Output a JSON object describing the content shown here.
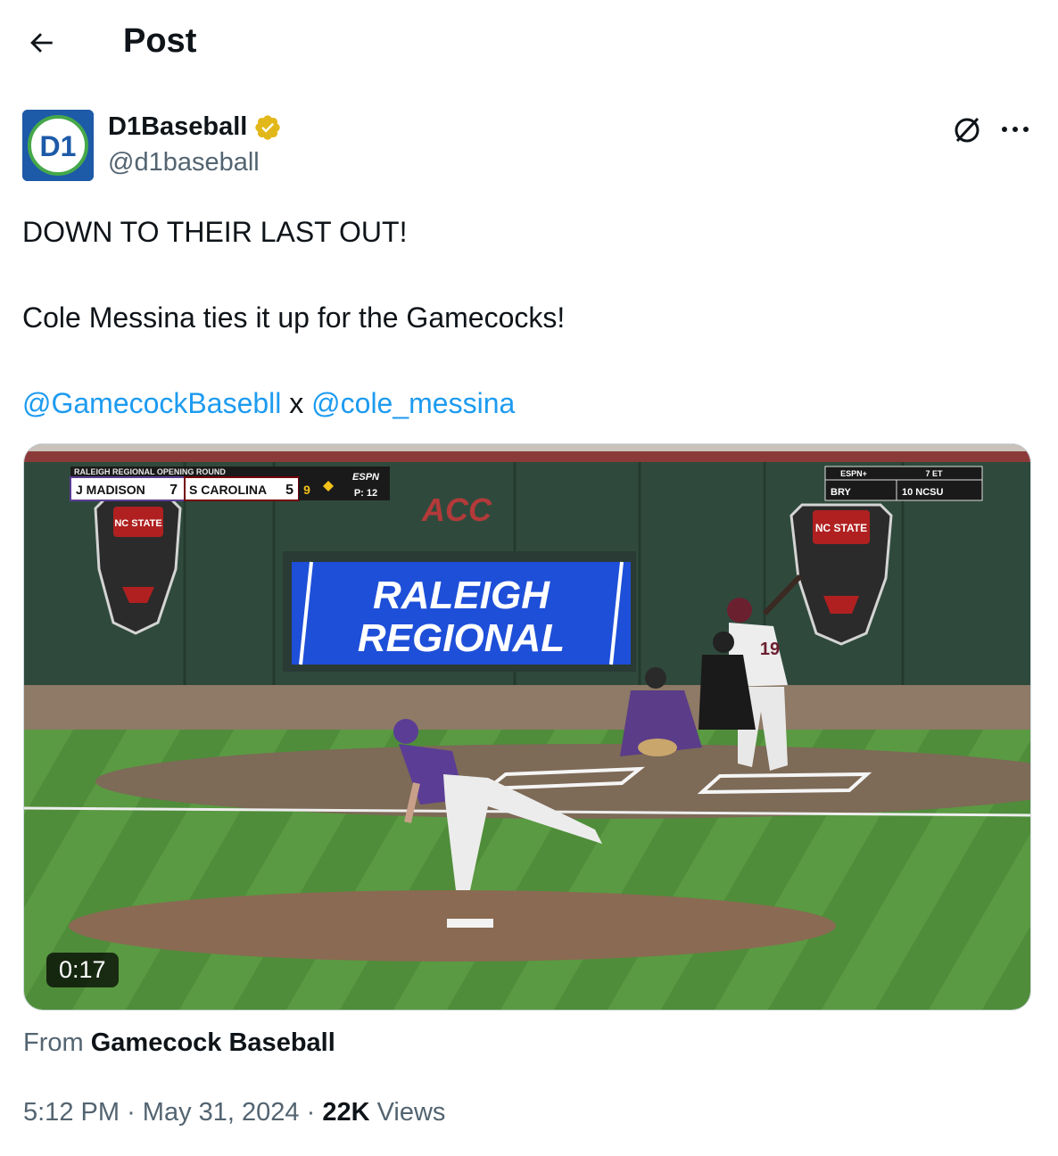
{
  "header": {
    "title": "Post"
  },
  "author": {
    "avatar_text": "D1",
    "name": "D1Baseball",
    "handle": "@d1baseball"
  },
  "post": {
    "line1": "DOWN TO THEIR LAST OUT!",
    "line2": "Cole Messina ties it up for the Gamecocks!",
    "mention1": "@GamecockBasebll",
    "mention_sep": " x ",
    "mention2": "@cole_messina"
  },
  "video": {
    "duration": "0:17",
    "scorebug": {
      "round": "RALEIGH REGIONAL OPENING ROUND",
      "team1": "J MADISON",
      "score1": "7",
      "team2": "S CAROLINA",
      "score2": "5",
      "inning": "9",
      "network": "ESPN",
      "pitch_count": "P: 12"
    },
    "ticker": {
      "network": "ESPN+",
      "time": "7 ET",
      "team1": "BRY",
      "team2": "10 NCSU"
    },
    "wall_logo": "ACC",
    "banner_line1": "RALEIGH",
    "banner_line2": "REGIONAL",
    "mascot_text": "NC STATE",
    "jersey_number": "19"
  },
  "footer": {
    "from_label": "From",
    "from_source": "Gamecock Baseball",
    "time": "5:12 PM",
    "sep": "·",
    "date": "May 31, 2024",
    "views_count": "22K",
    "views_label": "Views"
  },
  "colors": {
    "link": "#1d9bf0",
    "verified": "#e2b719",
    "muted": "#536471"
  }
}
